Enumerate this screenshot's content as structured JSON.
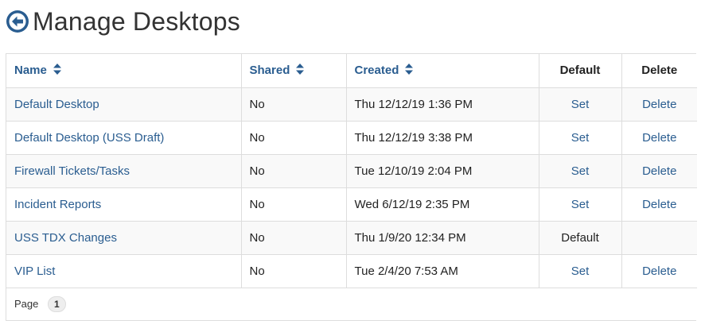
{
  "header": {
    "title": "Manage Desktops",
    "back_icon": "circle-arrow-left-icon",
    "accent_color": "#2a5d90"
  },
  "table": {
    "columns": [
      {
        "label": "Name",
        "sortable": true
      },
      {
        "label": "Shared",
        "sortable": true
      },
      {
        "label": "Created",
        "sortable": true
      },
      {
        "label": "Default",
        "sortable": false
      },
      {
        "label": "Delete",
        "sortable": false
      }
    ],
    "rows": [
      {
        "name": "Default Desktop",
        "shared": "No",
        "created": "Thu 12/12/19 1:36 PM",
        "default": "Set",
        "default_is_link": true,
        "delete": "Delete"
      },
      {
        "name": "Default Desktop (USS Draft)",
        "shared": "No",
        "created": "Thu 12/12/19 3:38 PM",
        "default": "Set",
        "default_is_link": true,
        "delete": "Delete"
      },
      {
        "name": "Firewall Tickets/Tasks",
        "shared": "No",
        "created": "Tue 12/10/19 2:04 PM",
        "default": "Set",
        "default_is_link": true,
        "delete": "Delete"
      },
      {
        "name": "Incident Reports",
        "shared": "No",
        "created": "Wed 6/12/19 2:35 PM",
        "default": "Set",
        "default_is_link": true,
        "delete": "Delete"
      },
      {
        "name": "USS TDX Changes",
        "shared": "No",
        "created": "Thu 1/9/20 12:34 PM",
        "default": "Default",
        "default_is_link": false,
        "delete": ""
      },
      {
        "name": "VIP List",
        "shared": "No",
        "created": "Tue 2/4/20 7:53 AM",
        "default": "Set",
        "default_is_link": true,
        "delete": "Delete"
      }
    ]
  },
  "pagination": {
    "label": "Page",
    "current_page": "1"
  }
}
